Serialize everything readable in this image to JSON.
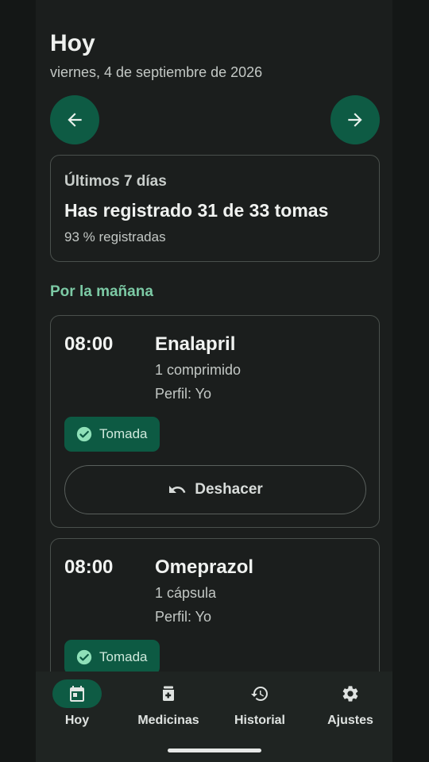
{
  "header": {
    "title": "Hoy",
    "date": "viernes, 4 de septiembre de 2026"
  },
  "nav_buttons": {
    "prev_icon": "arrow-left-icon",
    "next_icon": "arrow-right-icon"
  },
  "summary": {
    "label": "Últimos 7 días",
    "main": "Has registrado 31 de 33 tomas",
    "sub": "93 % registradas"
  },
  "section": {
    "label": "Por la mañana"
  },
  "doses": [
    {
      "time": "08:00",
      "name": "Enalapril",
      "amount": "1 comprimido",
      "profile": "Perfil: Yo",
      "status": "Tomada",
      "undo_label": "Deshacer"
    },
    {
      "time": "08:00",
      "name": "Omeprazol",
      "amount": "1 cápsula",
      "profile": "Perfil: Yo",
      "status": "Tomada"
    }
  ],
  "bottom_nav": {
    "items": [
      {
        "label": "Hoy",
        "icon": "calendar-icon",
        "active": true
      },
      {
        "label": "Medicinas",
        "icon": "medicine-icon",
        "active": false
      },
      {
        "label": "Historial",
        "icon": "history-icon",
        "active": false
      },
      {
        "label": "Ajustes",
        "icon": "settings-icon",
        "active": false
      }
    ]
  },
  "colors": {
    "background": "#1b1e1d",
    "accent": "#0e5b44",
    "section_label": "#7ccaa5",
    "chip_check": "#8fe0b8"
  }
}
